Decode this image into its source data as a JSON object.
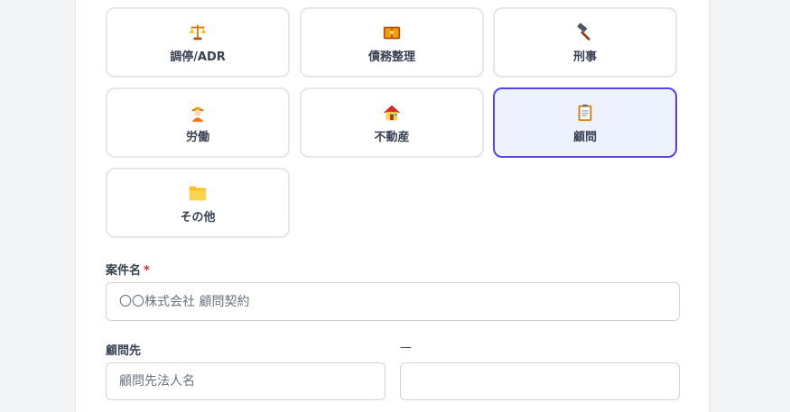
{
  "categories": [
    {
      "label": "調停/ADR",
      "icon": "scales-icon"
    },
    {
      "label": "債務整理",
      "icon": "money-bag-icon"
    },
    {
      "label": "刑事",
      "icon": "hammer-icon"
    },
    {
      "label": "労働",
      "icon": "worker-icon"
    },
    {
      "label": "不動産",
      "icon": "house-icon"
    },
    {
      "label": "顧問",
      "icon": "clipboard-icon",
      "selected": true
    },
    {
      "label": "その他",
      "icon": "folder-icon"
    }
  ],
  "form": {
    "case_name": {
      "label": "案件名",
      "required_mark": "*",
      "value": "",
      "placeholder": "〇〇株式会社 顧問契約"
    },
    "client": {
      "label": "顧問先",
      "value": "",
      "placeholder": "顧問先法人名"
    },
    "second": {
      "label": "—",
      "value": "",
      "placeholder": ""
    }
  },
  "colors": {
    "accent": "#4f46e5",
    "selected_bg": "#eef2ff",
    "required": "#dc2626"
  }
}
